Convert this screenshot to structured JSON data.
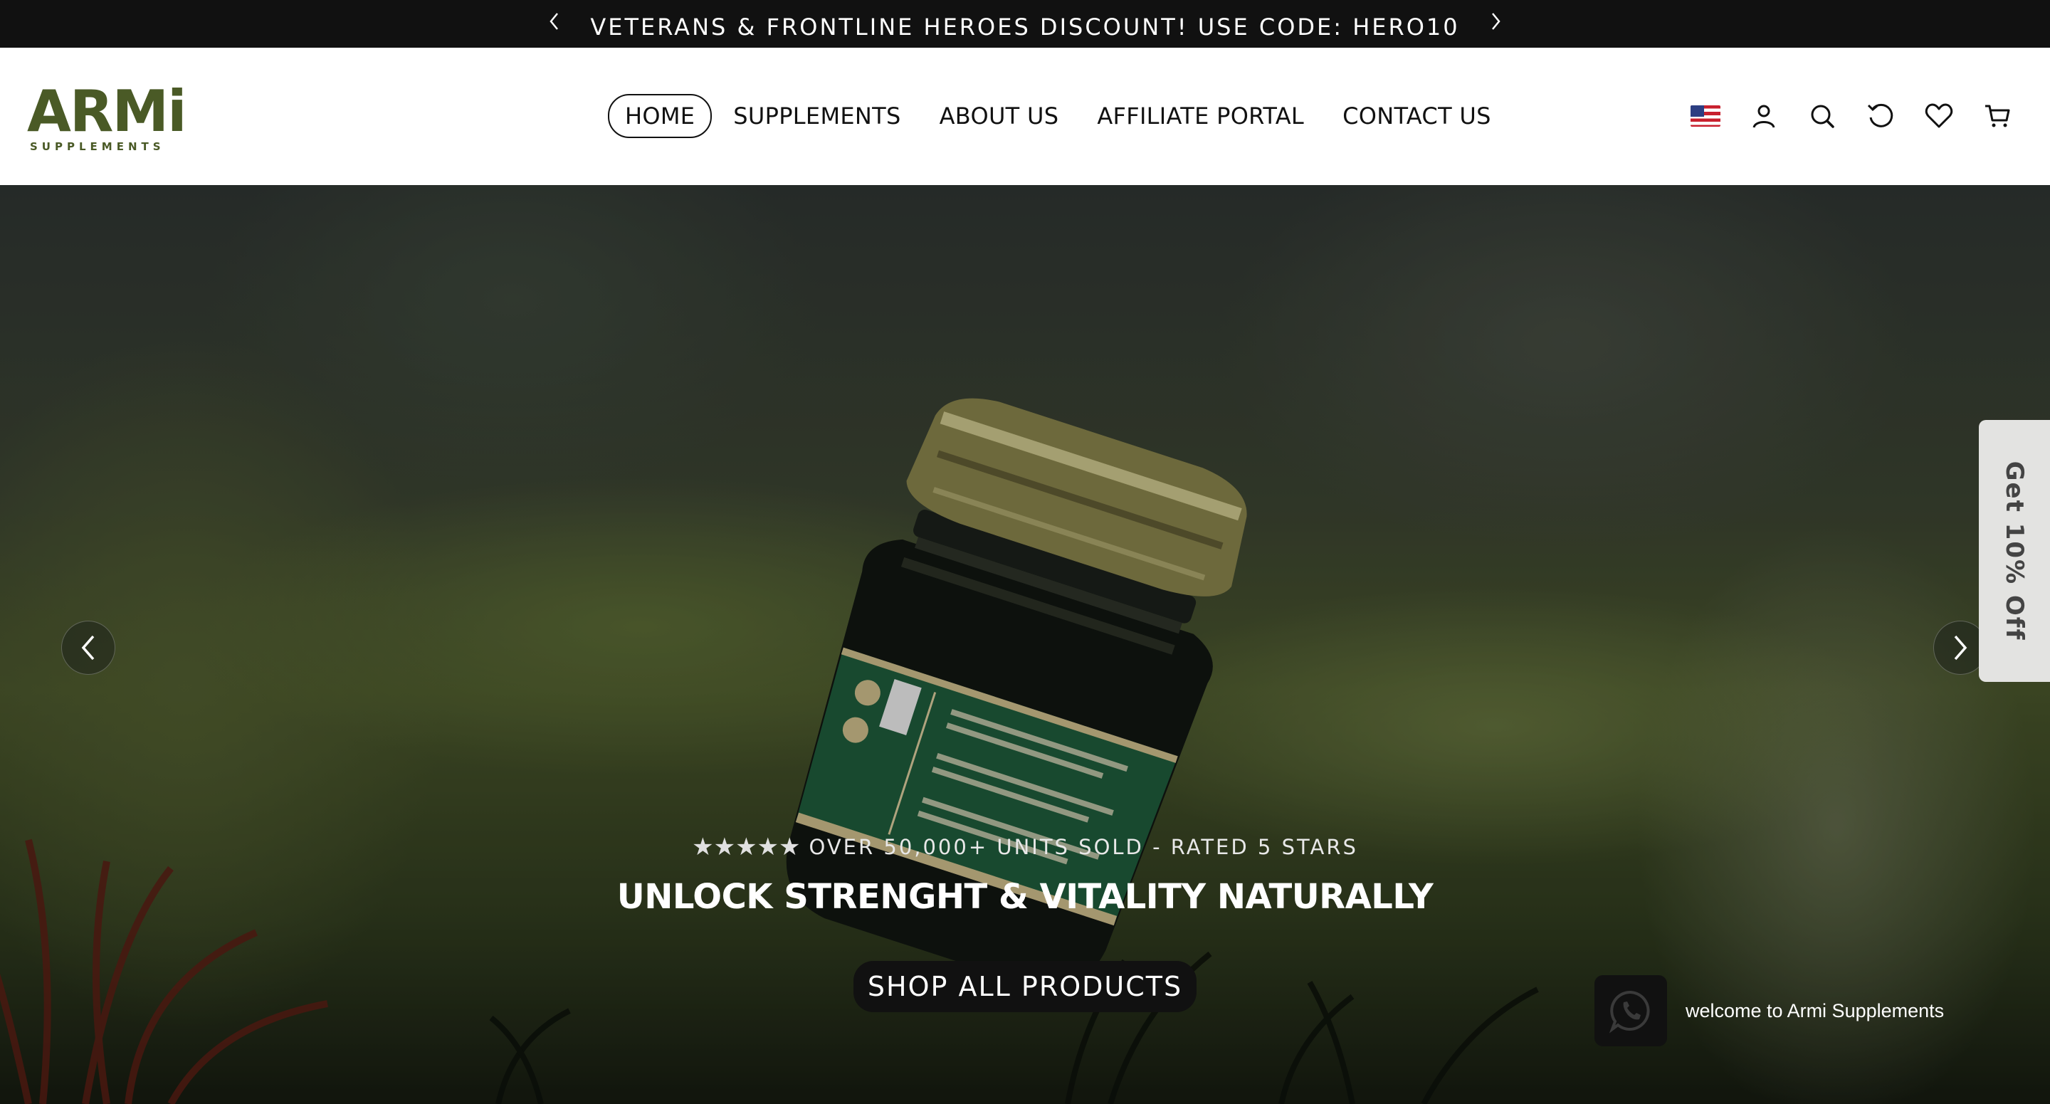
{
  "announcement": {
    "text": "VETERANS & FRONTLINE HEROES DISCOUNT! USE CODE: HERO10"
  },
  "brand": {
    "logo_main": "ARMi",
    "logo_sub": "SUPPLEMENTS",
    "color": "#4a5a26"
  },
  "nav": {
    "items": [
      {
        "label": "HOME",
        "active": true
      },
      {
        "label": "SUPPLEMENTS"
      },
      {
        "label": "ABOUT US"
      },
      {
        "label": "AFFILIATE PORTAL"
      },
      {
        "label": "CONTACT US"
      }
    ]
  },
  "header_icons": [
    "us-flag-icon",
    "account-icon",
    "search-icon",
    "recently-viewed-icon",
    "wishlist-heart-icon",
    "cart-icon"
  ],
  "hero": {
    "stars": "★★★★★",
    "rated": "OVER 50,000+ UNITS SOLD - RATED 5 STARS",
    "headline": "UNLOCK STRENGHT & VITALITY NATURALLY",
    "cta": "SHOP ALL PRODUCTS"
  },
  "side_tab": {
    "text": "Get 10% Off"
  },
  "chat": {
    "label": "welcome to Armi Supplements"
  },
  "colors": {
    "announcement_bg": "#111111",
    "header_bg": "#ffffff",
    "button_bg": "#111111"
  }
}
